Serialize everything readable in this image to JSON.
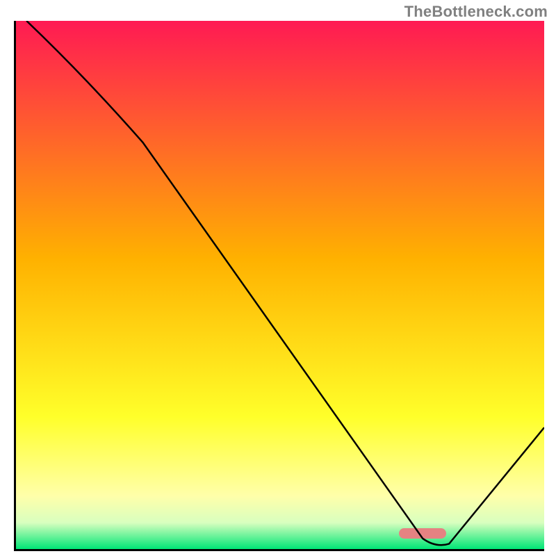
{
  "attribution": "TheBottleneck.com",
  "chart_data": {
    "type": "line",
    "title": "",
    "xlabel": "",
    "ylabel": "",
    "xlim": [
      0,
      100
    ],
    "ylim": [
      0,
      100
    ],
    "series": [
      {
        "name": "curve",
        "points": [
          {
            "x": 2,
            "y": 100
          },
          {
            "x": 24,
            "y": 77
          },
          {
            "x": 77,
            "y": 2
          },
          {
            "x": 80,
            "y": 1
          },
          {
            "x": 82,
            "y": 1
          },
          {
            "x": 100,
            "y": 23
          }
        ]
      }
    ],
    "background_gradient": {
      "stops": [
        {
          "pct": 0,
          "color": "#ff1a53"
        },
        {
          "pct": 45,
          "color": "#ffb100"
        },
        {
          "pct": 75,
          "color": "#ffff2a"
        },
        {
          "pct": 90,
          "color": "#ffffaa"
        },
        {
          "pct": 95,
          "color": "#d9ffbf"
        },
        {
          "pct": 100,
          "color": "#00e676"
        }
      ]
    },
    "marker": {
      "x_center_pct": 77,
      "y_pct": 3,
      "width_pct": 9,
      "height_pct": 2,
      "color": "#e58282"
    },
    "grid": false,
    "legend": false
  }
}
